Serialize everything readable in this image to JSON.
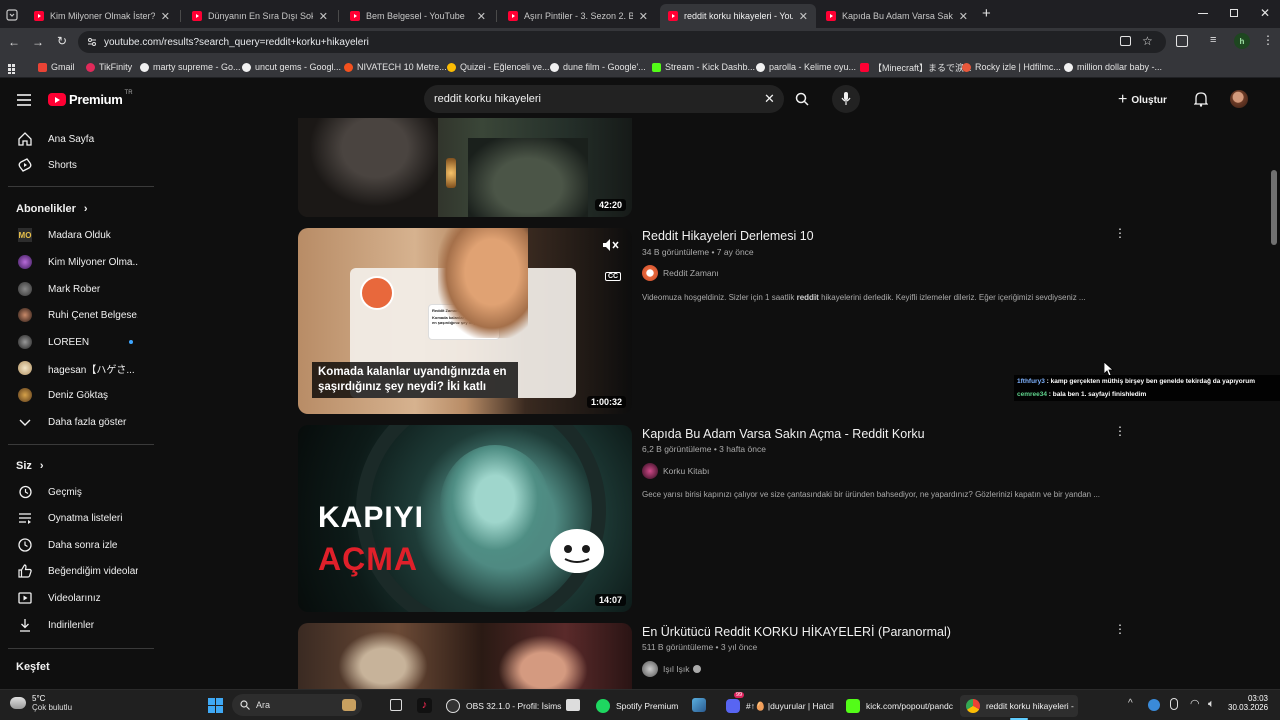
{
  "browser": {
    "tabs": [
      {
        "title": "Kim Milyoner Olmak İster? 1. Bö",
        "active": false
      },
      {
        "title": "Dünyanın En Sıra Dışı Sokak Yem",
        "active": false
      },
      {
        "title": "Bem Belgesel - YouTube",
        "active": false
      },
      {
        "title": "Aşırı Pintiler - 3. Sezon 2. Bölüm",
        "active": false
      },
      {
        "title": "reddit korku hikayeleri - YouTube",
        "active": true
      },
      {
        "title": "Kapıda Bu Adam Varsa Sakın Aç",
        "active": false
      }
    ],
    "new_tab": "+",
    "url": "youtube.com/results?search_query=reddit+korku+hikayeleri",
    "profile_initial": "h",
    "bookmarks": [
      "Gmail",
      "TikFinity",
      "marty supreme - Go...",
      "uncut gems - Googl...",
      "NIVATECH 10 Metre...",
      "Quizei - Eğlenceli ve...",
      "dune film - Google'...",
      "Stream - Kick Dashb...",
      "parolla - Kelime oyu...",
      "【Minecraft】まるで涙...",
      "Rocky izle | Hdfilmc...",
      "million dollar baby -..."
    ]
  },
  "youtube": {
    "logo_text": "Premium",
    "logo_sup": "TR",
    "search_value": "reddit korku hikayeleri",
    "create_label": "Oluştur",
    "sidebar": {
      "top_items": [
        "Ana Sayfa",
        "Shorts"
      ],
      "subs_header": "Abonelikler",
      "subs": [
        {
          "name": "Madara Olduk",
          "dot": false
        },
        {
          "name": "Kim Milyoner Olma...",
          "dot": false
        },
        {
          "name": "Mark Rober",
          "dot": false
        },
        {
          "name": "Ruhi Çenet Belgese...",
          "dot": false
        },
        {
          "name": "LOREEN",
          "dot": true
        },
        {
          "name": "hagesan【ハゲさ...",
          "dot": false
        },
        {
          "name": "Deniz Göktaş",
          "dot": false
        }
      ],
      "show_more": "Daha fazla göster",
      "you_header": "Siz",
      "you_items": [
        "Geçmiş",
        "Oynatma listeleri",
        "Daha sonra izle",
        "Beğendiğim videolar",
        "Videolarınız",
        "İndirilenler"
      ],
      "explore_header": "Keşfet"
    },
    "results": [
      {
        "duration": "42:20"
      },
      {
        "title": "Reddit Hikayeleri Derlemesi 10",
        "meta": "34 B görüntüleme • 7 ay önce",
        "channel": "Reddit Zamanı",
        "desc_pre": "Videomuza hoşgeldiniz. Sizler için 1 saatlik ",
        "desc_bold": "reddit",
        "desc_post": " hikayelerini derledik. Keyifli izlemeler dileriz. Eğer içeriğimizi sevdiyseniz ...",
        "duration": "1:00:32",
        "thumb_caption": "Komada kalanlar uyandığınızda en şaşırdığınız şey neydi? İki katlı",
        "thumb_small_title": "Reddit Zamanı",
        "thumb_card_text": "Komada kalanlar uyandığınızda en şaşırdığınız şey neydi?",
        "cc": "CC"
      },
      {
        "title": "Kapıda Bu Adam Varsa Sakın Açma - Reddit Korku",
        "meta": "6,2 B görüntüleme • 3 hafta önce",
        "channel": "Korku Kitabı",
        "desc": "Gece yarısı birisi kapınızı çalıyor ve size çantasındaki bir üründen bahsediyor, ne yapardınız? Gözlerinizi kapatın ve bir yandan ...",
        "duration": "14:07",
        "thumb_line1": "KAPIYI",
        "thumb_line2": "AÇMA"
      },
      {
        "title": "En Ürkütücü Reddit KORKU HİKAYELERİ (Paranormal)",
        "meta": "511 B görüntüleme • 3 yıl önce",
        "channel": "Işıl Işık"
      }
    ]
  },
  "chat": [
    {
      "user": "1fthfury3",
      "text": " : kamp gerçekten müthiş birşey ben genelde tekirdağ da yapıyorum",
      "color": "#7fb3ff"
    },
    {
      "user": "cemree34",
      "text": " : bala ben 1. sayfayi finishledim",
      "color": "#5fd38d"
    }
  ],
  "taskbar": {
    "weather_temp": "5°C",
    "weather_desc": "Çok bulutlu",
    "search": "Ara",
    "apps": [
      "OBS 32.1.0 - Profil: İsims",
      "Spotify Premium",
      "#↑🥚 |duyurular | Hatcil",
      "kick.com/popout/pandc",
      "reddit korku hikayeleri -"
    ],
    "discord_badge": "99",
    "time": "03:03",
    "date": "30.03.2026"
  },
  "colors": {
    "accent_red": "#ff0033",
    "bg": "#0f0f0f",
    "text": "#f1f1f1",
    "muted": "#aaaaaa"
  }
}
